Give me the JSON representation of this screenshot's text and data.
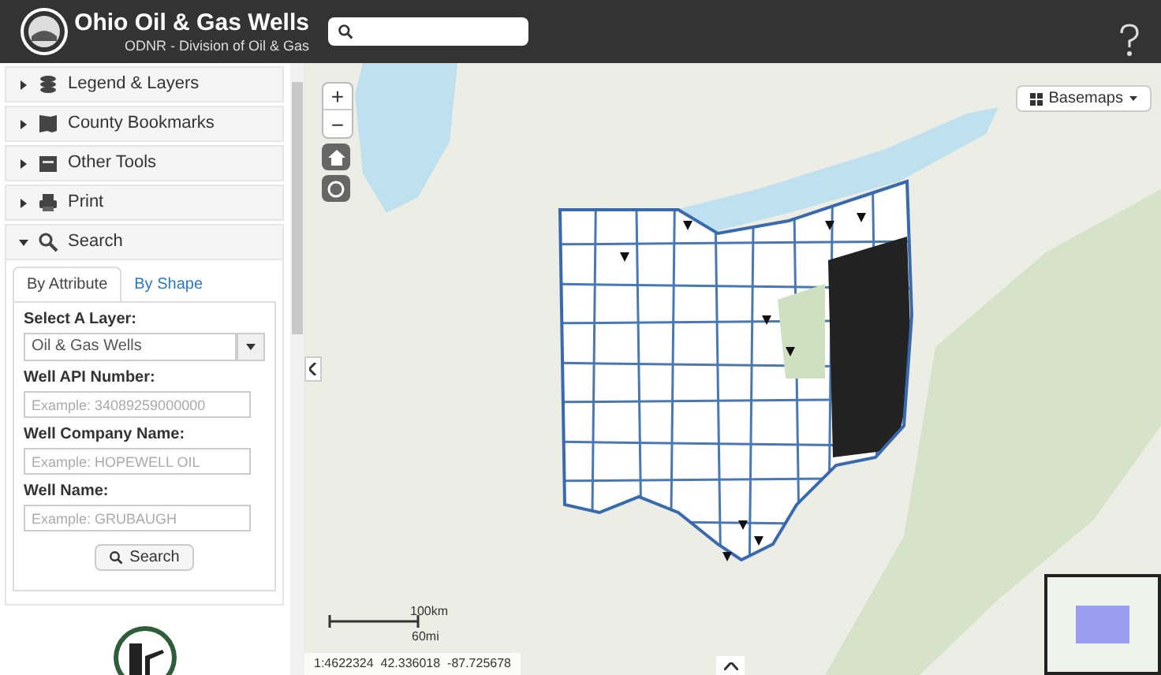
{
  "header": {
    "title": "Ohio Oil & Gas Wells",
    "subtitle": "ODNR - Division of Oil & Gas"
  },
  "panels": [
    {
      "kind": "layers",
      "label": "Legend & Layers",
      "expanded": false
    },
    {
      "kind": "bookmarks",
      "label": "County Bookmarks",
      "expanded": false
    },
    {
      "kind": "tools",
      "label": "Other Tools",
      "expanded": false
    },
    {
      "kind": "print",
      "label": "Print",
      "expanded": false
    },
    {
      "kind": "search",
      "label": "Search",
      "expanded": true
    }
  ],
  "search": {
    "tabs": [
      {
        "label": "By Attribute",
        "selected": true
      },
      {
        "label": "By Shape",
        "selected": false
      }
    ],
    "fields": [
      {
        "kind": "select",
        "label": "Select A Layer:",
        "value": "Oil & Gas Wells"
      },
      {
        "kind": "text",
        "label": "Well API Number:",
        "placeholder": "Example: 34089259000000"
      },
      {
        "kind": "text",
        "label": "Well Company Name:",
        "placeholder": "Example: HOPEWELL OIL"
      },
      {
        "kind": "text",
        "label": "Well Name:",
        "placeholder": "Example: GRUBAUGH"
      }
    ],
    "button": "Search"
  },
  "map": {
    "zoom_in": "+",
    "zoom_out": "−",
    "basemaps": "Basemaps",
    "scale": {
      "km": "100km",
      "mi": "60mi"
    },
    "coordinates": "1:4622324  42.336018  -87.725678"
  }
}
